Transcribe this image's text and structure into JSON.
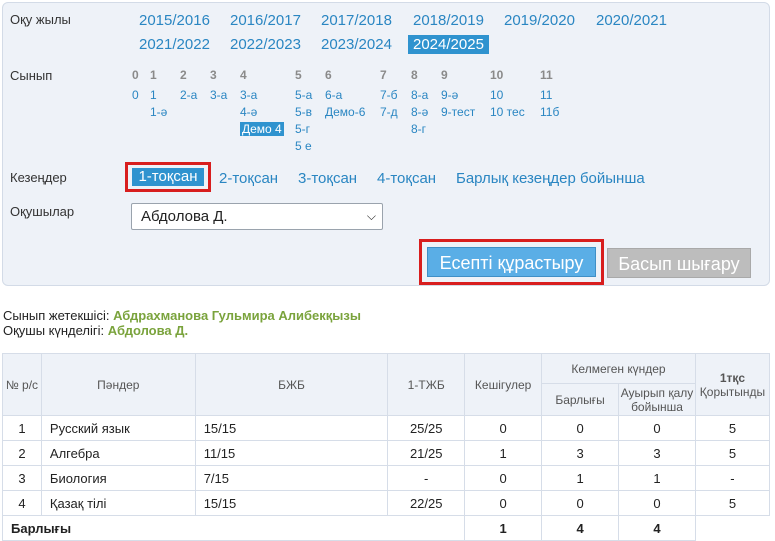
{
  "filters": {
    "year_label": "Оқу жылы",
    "years": [
      "2015/2016",
      "2016/2017",
      "2017/2018",
      "2018/2019",
      "2019/2020",
      "2020/2021",
      "2021/2022",
      "2022/2023",
      "2023/2024",
      "2024/2025"
    ],
    "active_year": "2024/2025",
    "class_label": "Сынып",
    "class_groups": [
      {
        "head": "0",
        "items": [
          "0"
        ]
      },
      {
        "head": "1",
        "items": [
          "1",
          "1-ә"
        ]
      },
      {
        "head": "2",
        "items": [
          "2-а"
        ]
      },
      {
        "head": "3",
        "items": [
          "3-а"
        ]
      },
      {
        "head": "4",
        "items": [
          "3-а",
          "4-ә",
          "Демо 4"
        ]
      },
      {
        "head": "5",
        "items": [
          "5-а",
          "5-в",
          "5-г",
          "5 е"
        ]
      },
      {
        "head": "6",
        "items": [
          "6-а",
          "Демо-6"
        ]
      },
      {
        "head": "7",
        "items": [
          "7-б",
          "7-д"
        ]
      },
      {
        "head": "8",
        "items": [
          "8-а",
          "8-ә",
          "8-г"
        ]
      },
      {
        "head": "9",
        "items": [
          "9-ә",
          "9-тест"
        ]
      },
      {
        "head": "10",
        "items": [
          "10",
          "10 тес"
        ]
      },
      {
        "head": "11",
        "items": [
          "11",
          "11б"
        ]
      }
    ],
    "active_class": "Демо 4",
    "period_label": "Кезеңдер",
    "periods": [
      "1-тоқсан",
      "2-тоқсан",
      "3-тоқсан",
      "4-тоқсан",
      "Барлық кезеңдер бойынша"
    ],
    "active_period": "1-тоқсан",
    "student_label": "Оқушылар",
    "student_value": "Абдолова Д.",
    "build_button": "Есепті құрастыру",
    "print_button": "Басып шығару"
  },
  "info": {
    "teacher_label": "Сынып жетекшісі:",
    "teacher_value": "Абдрахманова Гульмира Алибекқызы",
    "diary_label": "Оқушы күнделігі:",
    "diary_value": "Абдолова Д."
  },
  "table": {
    "headers": {
      "num": "№ р/с",
      "subject": "Пәндер",
      "bjb": "БЖБ",
      "tjb": "1-ТЖБ",
      "late": "Кешігулер",
      "absent_group": "Келмеген күндер",
      "absent_total": "Барлығы",
      "absent_sick": "Ауырып қалу бойынша",
      "final_a": "1тқс",
      "final_b": "Қорытынды"
    },
    "rows": [
      [
        "1",
        "Русский язык",
        "15/15",
        "25/25",
        "0",
        "0",
        "0",
        "5"
      ],
      [
        "2",
        "Алгебра",
        "11/15",
        "21/25",
        "1",
        "3",
        "3",
        "5"
      ],
      [
        "3",
        "Биология",
        "7/15",
        "-",
        "0",
        "1",
        "1",
        "-"
      ],
      [
        "4",
        "Қазақ тілі",
        "15/15",
        "22/25",
        "0",
        "0",
        "0",
        "5"
      ]
    ],
    "total": {
      "label": "Барлығы",
      "late": "1",
      "absent_total": "4",
      "absent_sick": "4"
    }
  }
}
